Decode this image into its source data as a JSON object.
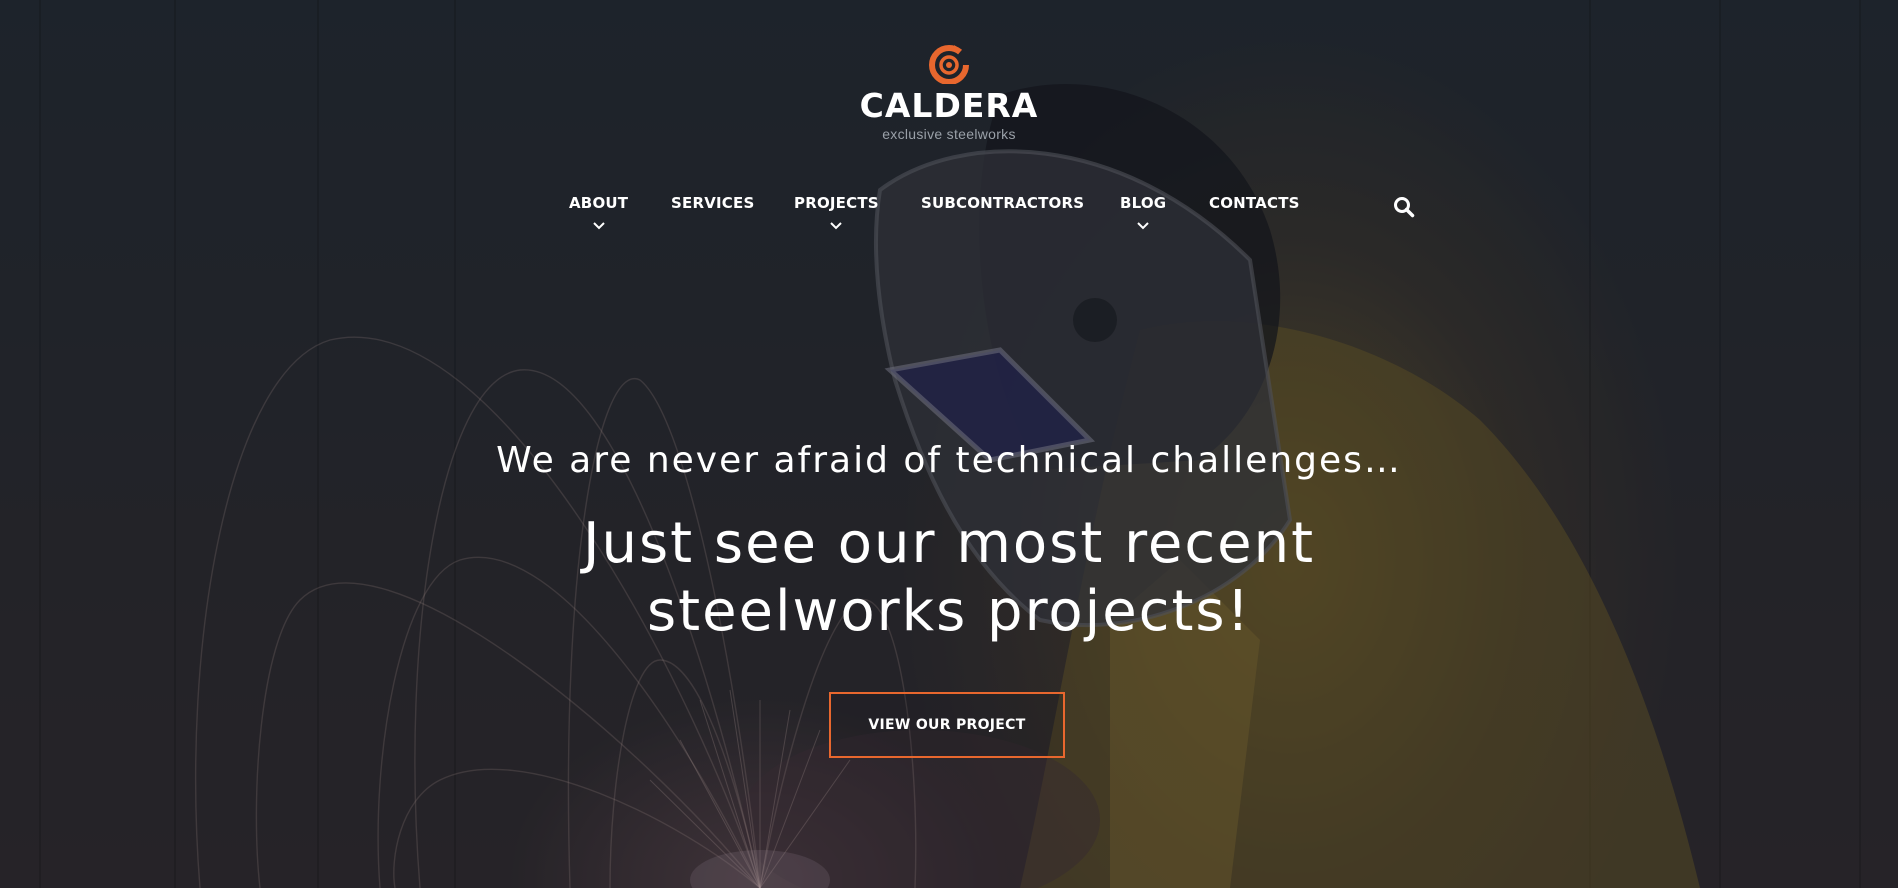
{
  "brand": {
    "name": "CALDERA",
    "tagline": "exclusive steelworks",
    "accent_color": "#e8672e",
    "logo_icon": "spiral-logo-icon"
  },
  "nav": {
    "items": [
      {
        "label": "ABOUT",
        "has_dropdown": true
      },
      {
        "label": "SERVICES",
        "has_dropdown": false
      },
      {
        "label": "PROJECTS",
        "has_dropdown": true
      },
      {
        "label": "SUBCONTRACTORS",
        "has_dropdown": false
      },
      {
        "label": "BLOG",
        "has_dropdown": true
      },
      {
        "label": "CONTACTS",
        "has_dropdown": false
      }
    ],
    "search_icon": "search-icon"
  },
  "hero": {
    "subheadline": "We are never afraid of technical challenges…",
    "headline_line1": "Just see our most recent",
    "headline_line2": "steelworks projects!",
    "cta_label": "VIEW OUR PROJECT"
  }
}
